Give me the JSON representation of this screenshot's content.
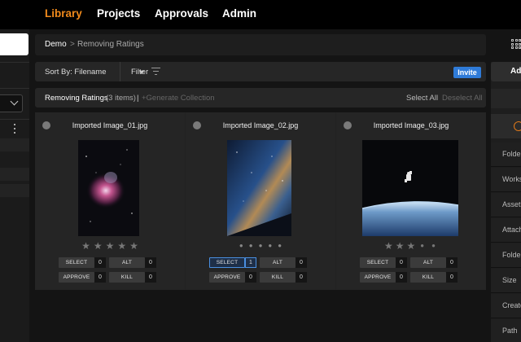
{
  "nav": {
    "items": [
      {
        "label": "Library",
        "active": true
      },
      {
        "label": "Projects"
      },
      {
        "label": "Approvals"
      },
      {
        "label": "Admin"
      }
    ]
  },
  "breadcrumb": {
    "root": "Demo",
    "sep": ">",
    "current": "Removing Ratings"
  },
  "toolbar": {
    "sort": "Sort By: Filename",
    "filter": "Filter",
    "invite": "Invite"
  },
  "collection": {
    "title": "Removing Ratings",
    "count": "(3 items)",
    "divider": "|",
    "generate": "+Generate Collection",
    "select_all": "Select All",
    "deselect_all": "Deselect All"
  },
  "right_panel": {
    "add": "Ad",
    "items": [
      "Folde",
      "Works",
      "Asset",
      "Attach",
      "Folde",
      "Size",
      "Create",
      "Path"
    ]
  },
  "cards": [
    {
      "filename": "Imported Image_01.jpg",
      "rating_style": "stars",
      "rating": 0,
      "max_rating": 5,
      "select": "0",
      "alt": "0",
      "approve": "0",
      "kill": "0",
      "selected": false
    },
    {
      "filename": "Imported Image_02.jpg",
      "rating_style": "dots",
      "rating": 0,
      "max_rating": 5,
      "select": "1",
      "alt": "0",
      "approve": "0",
      "kill": "0",
      "selected": true
    },
    {
      "filename": "Imported Image_03.jpg",
      "rating_style": "mixed",
      "rating": 0,
      "max_rating": 5,
      "select": "0",
      "alt": "0",
      "approve": "0",
      "kill": "0",
      "selected": false
    }
  ],
  "labels": {
    "select": "SELECT",
    "alt": "ALT",
    "approve": "APPROVE",
    "kill": "KILL"
  },
  "colors": {
    "accent_orange": "#f08a1c",
    "invite_blue": "#2f7bd8",
    "selected_blue": "#4a8fe0"
  }
}
